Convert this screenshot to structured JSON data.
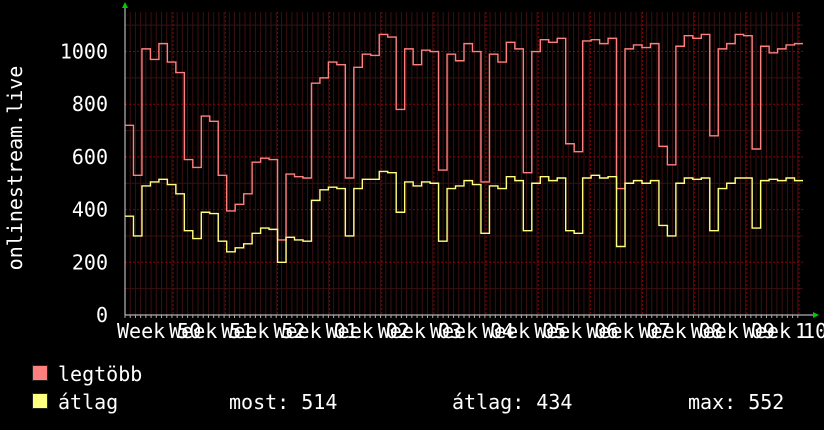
{
  "chart_data": {
    "type": "line",
    "ylabel": "onlinestream.live",
    "ylim": [
      0,
      1150
    ],
    "yticks": [
      0,
      200,
      400,
      600,
      800,
      1000
    ],
    "xticks": [
      "Week 50",
      "Week 51",
      "Week 52",
      "Week 01",
      "Week 02",
      "Week 03",
      "Week 04",
      "Week 05",
      "Week 06",
      "Week 07",
      "Week 08",
      "Week 09",
      "Week 10",
      "1"
    ],
    "grid": true,
    "background": "#000000",
    "grid_color": "#8b0000",
    "series": [
      {
        "name": "legtöbb",
        "color": "#ff7f7f",
        "values": [
          720,
          530,
          1010,
          970,
          1030,
          960,
          920,
          590,
          560,
          755,
          735,
          530,
          395,
          420,
          460,
          580,
          595,
          590,
          285,
          535,
          525,
          520,
          880,
          900,
          960,
          950,
          520,
          940,
          990,
          985,
          1065,
          1055,
          780,
          1010,
          950,
          1005,
          1000,
          550,
          990,
          965,
          1030,
          1000,
          505,
          990,
          960,
          1035,
          1010,
          540,
          1000,
          1045,
          1035,
          1050,
          650,
          620,
          1040,
          1045,
          1030,
          1050,
          480,
          1010,
          1025,
          1015,
          1030,
          640,
          570,
          1020,
          1060,
          1050,
          1065,
          680,
          1010,
          1030,
          1065,
          1060,
          630,
          1020,
          995,
          1010,
          1025,
          1030
        ]
      },
      {
        "name": "átlag",
        "color": "#ffff7f",
        "values": [
          375,
          300,
          490,
          505,
          515,
          495,
          460,
          320,
          290,
          390,
          385,
          280,
          240,
          255,
          270,
          310,
          330,
          325,
          200,
          295,
          285,
          280,
          435,
          475,
          485,
          480,
          300,
          480,
          515,
          515,
          545,
          540,
          390,
          505,
          490,
          505,
          500,
          280,
          480,
          490,
          510,
          495,
          310,
          490,
          480,
          525,
          510,
          320,
          500,
          525,
          510,
          520,
          320,
          310,
          520,
          530,
          520,
          525,
          260,
          500,
          510,
          500,
          510,
          340,
          300,
          500,
          520,
          515,
          520,
          320,
          480,
          500,
          520,
          520,
          330,
          510,
          515,
          510,
          520,
          510
        ]
      }
    ]
  },
  "legend": {
    "max_label": "legtöbb",
    "avg_label": "átlag",
    "max_color": "#ff7f7f",
    "avg_color": "#ffff7f"
  },
  "stats": {
    "current": "most: 514",
    "average": "átlag: 434",
    "maximum": "max: 552"
  }
}
